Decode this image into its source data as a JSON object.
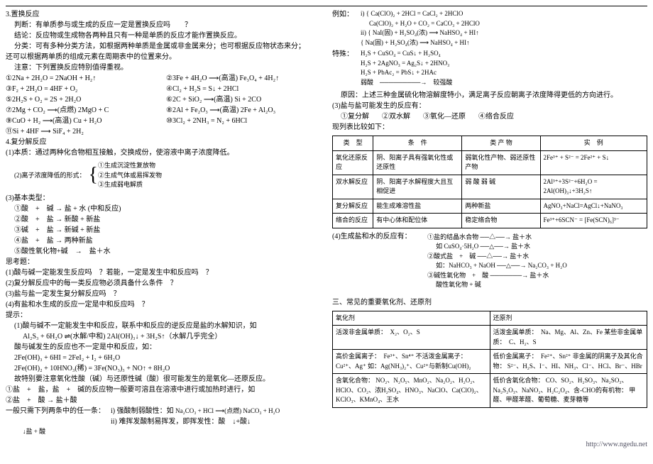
{
  "left": {
    "s3_title": "3.置换反应",
    "s3_l1": "判断：有单质参与或生成的反应一定是置换反应吗　　？",
    "s3_l2": "结论：反应物或生成物各两种且只有一种是单质的反应才能作置换反应。",
    "s3_l3": "分类：可有多种分类方法，如根据两种单质是金属或非金属来分；也可根据反应物状态来分；",
    "s3_l4": "还可以根据两单质的组成元素在周期表中的位置来分。",
    "s3_l5": "注意：下列置换反应特别值得重视。",
    "rxA1": "①2Na + 2H₂O = 2NaOH + H₂↑",
    "rxA2": "②3Fe + 4H₂O ⟶(高温) Fe₃O₄ + 4H₂↑",
    "rxA3": "③F₂ + 2H₂O = 4HF + O₂",
    "rxA4": "④Cl₂ + H₂S = S↓ + 2HCl",
    "rxA5": "⑤2H₂S + O₂ = 2S + 2H₂O",
    "rxA6": "⑥2C + SiO₂ ⟶(高温) Si + 2CO",
    "rxA7": "⑦2Mg + CO₂ ⟶(点燃) 2MgO + C",
    "rxA8": "⑧2Al + Fe₂O₃ ⟶(高温) 2Fe + Al₂O₃",
    "rxA9": "⑨CuO + H₂ ⟶(高温) Cu + H₂O",
    "rxA10": "⑩3Cl₂ + 2NH₃ = N₂ + 6HCl",
    "rxA11": "⑪Si + 4HF ⟶ SiF₄ + 2H₂",
    "s4_title": "4.复分解反应",
    "s4_l1": "(1)本质：通过两种化合物相互接触，交换成份，使溶液中离子浓度降低。",
    "s4_l2_label": "(2)离子浓度降低的形式：",
    "s4_l2a": "①生成沉淀性复放物",
    "s4_l2b": "②生成气体或易挥发物",
    "s4_l2c": "③生成弱电解质",
    "s4_l3": "(3)基本类型：",
    "bt1": "①酸　+　碱 → 盐 + 水 (中和反应)",
    "bt2": "②酸　+　盐 → 新酸 + 新盐",
    "bt3": "③碱　+　盐 → 新碱 + 新盐",
    "bt4": "④盐　+　盐 → 两种新盐",
    "bt5": "⑤酸性氧化物+碱　→　盐＋水",
    "think": "思考题：",
    "q1": "(1)酸与碱一定能发生反应吗　？若能，一定是发生中和反应吗　？",
    "q2": "(2)复分解反应中的每一类反应物必须具备什么条件　？",
    "q3": "(3)盐与盐一定发生复分解反应吗　？",
    "q4": "(4)有盐和水生成的反应一定是中和反应吗　？",
    "hint": "提示：",
    "hint1": "(1)酸与碱不一定能发生中和反应，联系中和反应的逆反应是盐的水解知识，如",
    "hint1_eq": "Al₂S₃ + 6H₂O ⇌(水解/中和) 2Al(OH)₃↓ + 3H₂S↑（水解几乎完全）",
    "hint2": "酸与碱发生的反应也不一定是中和反应，如：",
    "hint2a": "2Fe(OH)₃ + 6HI = 2FeI₂ + I₂ + 6H₂O",
    "hint2b": "2Fe(OH)₂ + 10HNO₃(稀) = 3Fe(NO₃)₃ + NO↑ + 8H₂O",
    "hint2c": "故特别要注意氧化性酸（碱）与还原性碱（酸）很可能发生的是氧化—还原反应。",
    "sub1": "①盐　+　盐，盐　+　碱的反应物一般要可溶且在溶液中进行或加热时进行，如",
    "sub2": "②盐　+　酸 → 盐＋酸",
    "sub3_label": "一般只需下列两条中的任一条：",
    "sub3a": "i) 强酸制弱酸性：如",
    "sub3a_eq": "Na₂CO₃ + HCl ⟶(点燃) NaCO₃ + H₂O",
    "sub3b": "ii) 难挥发酸制易挥发，即挥发性：酸　↓+酸↓",
    "sub_eq": "↓盐 + 酸"
  },
  "right": {
    "ex_label": "例如：",
    "ex_i": "i) { Ca(ClO)₂ + 2HCl = CaCl₂ + 2HClO",
    "ex_i2": "Ca(ClO)₂ + H₂O + CO₂ = CaCO₃ + 2HClO",
    "ex_ii": "ii) { NaI(固) + H₂SO₄(浓) ⟶ NaHSO₄ + HI↑",
    "ex_ii2": "{ Na(固) + H₂SO₄(浓) ⟶ NaHSO₄ + HI↑",
    "sp_label": "特殊：",
    "sp1": "H₂S + CuSO₄ = CuS↓ + H₂SO₄",
    "sp2": "H₂S + 2AgNO₃ = Ag₂S↓ + 2HNO₃",
    "sp3": "H₂S + PbAc₂ = PbS↓ + 2HAc",
    "sp_arrow": "弱酸　─────────→　较强酸",
    "reason": "原因：上述三种金属硫化物溶解度特小，满足离子反应朝离子浓度降得更低的方向进行。",
    "s3r": "(3)盐与盐可能发生的反应有：",
    "tabA": "①复分解",
    "tabB": "②双水解",
    "tabC": "③氧化—还原",
    "tabD": "④络合反应",
    "cmp": "现列表比较如下：",
    "th1": "类　型",
    "th2": "条　件",
    "th3": "类 产 物",
    "th4": "实　例",
    "r1c1": "氧化还原反应",
    "r1c2": "阴、阳离子具有强氧化性或还原性",
    "r1c3": "弱氧化性产物、弱还原性产物",
    "r1c4": "2Fe³⁺ + S²⁻ = 2Fe²⁺ + S↓",
    "r2c1": "双水解反应",
    "r2c2": "阴、阳离子水解程度大且互相促进",
    "r2c3": "弱 酸\n弱 碱",
    "r2c4": "2Al³⁺+3S²⁻+6H₂O = 2Al(OH)₃↓+3H₂S↑",
    "r3c1": "复分解反应",
    "r3c2": "能生成难溶性盐",
    "r3c3": "两种新盐",
    "r3c4": "AgNO₃+NaCl=AgCl↓+NaNO₃",
    "r4c1": "络合的反应",
    "r4c2": "有中心体和配位体",
    "r4c3": "稳定络合物",
    "r4c4": "Fe³⁺+6SCN⁻ = [Fe(SCN)₆]³⁻",
    "s4r": "(4)生成盐和水的反应有：",
    "gen1": "①盐的结晶水合物 ──△──→ 盐＋水",
    "gen1a": "如 CuSO₄·5H₂O ──△──→ 盐＋水",
    "gen2": "②酸式盐　+　碱 ──△──→ 盐＋水",
    "gen2a": "如：NaHCO₃ + NaOH ──△──→ Na₂CO₃ + H₂O",
    "gen3": "③碱性氧化物　+　酸 ───────→ 盐＋水",
    "gen3a": "酸性氧化物 + 碱",
    "sec3_title": "三、常见的重要氧化剂、还原剂",
    "oth": "氧化剂",
    "rth": "还原剂",
    "o1": "活泼非金属单质：　X₂、O₂、S",
    "r1": "活泼金属单质：　Na、Mg、Al、Zn、Fe\n某些非金属单质：　C、H₂、S",
    "o2": "高价金属离子：　Fe³⁺、Sn⁴⁺\n不活泼金属离子：　Cu²⁺、Ag⁺\n如：Ag(NH₃)₂⁺、Cu²⁺与新制Cu(OH)₂",
    "r2": "低价金属离子：　Fe²⁺、Sn²⁺\n非金属的阴离子及其化合物：\nS²⁻、H₂S、I⁻、HI、NH₃、Cl⁻、HCl、Br⁻、HBr",
    "o3": "含氧化合物：\nNO₂、N₂O₅、MnO₂、Na₂O₂、H₂O₂、HClO、CO₂、浓H₂SO₄、HNO₃、NaClO、Ca(ClO)₂、KClO₃、KMnO₄、王水",
    "r3": "低价含氧化合物：\nCO、SO₂、H₂SO₃、Na₂SO₃、Na₂S₂O₃、NaNO₂、H₂C₂O₄、含-CHO的有机物：\n甲醛、甲醛苯醛、葡萄糖、麦芽糖等"
  },
  "footer": "http://www.ngedu.net"
}
